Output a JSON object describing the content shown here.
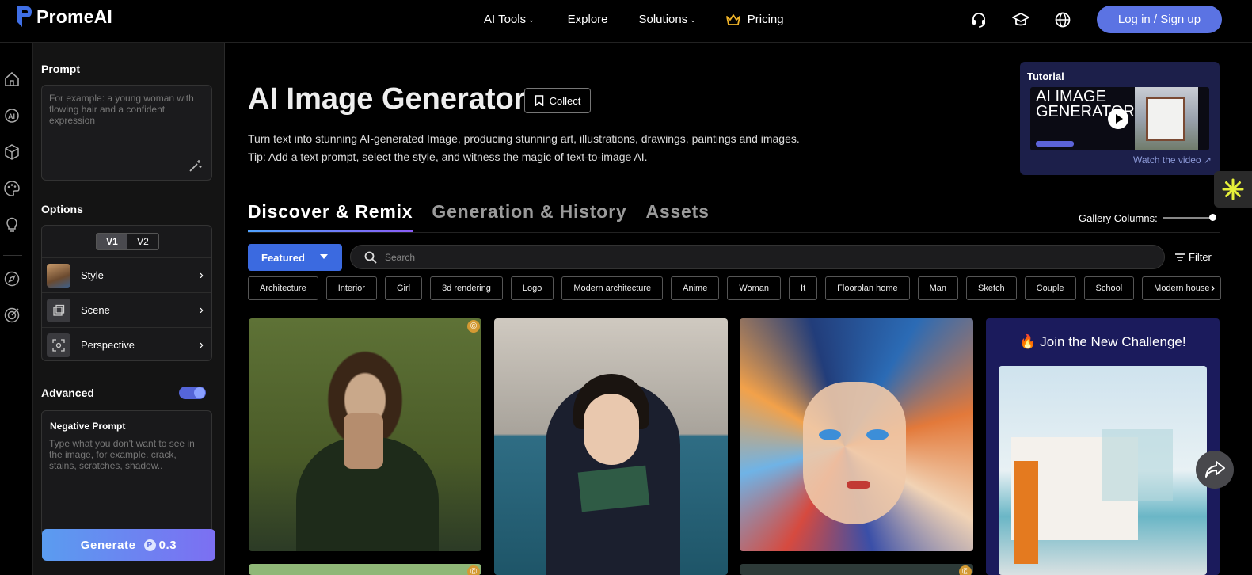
{
  "brand": {
    "name": "PromeAI"
  },
  "nav": {
    "ai_tools": "AI Tools",
    "explore": "Explore",
    "solutions": "Solutions",
    "pricing": "Pricing",
    "login": "Log in / Sign up"
  },
  "panel": {
    "prompt_heading": "Prompt",
    "prompt_placeholder": "For example: a young woman with flowing hair and a confident expression",
    "options_heading": "Options",
    "version_v1": "V1",
    "version_v2": "V2",
    "selected_version": "V1",
    "options": [
      {
        "label": "Style",
        "icon": "style-thumbnail"
      },
      {
        "label": "Scene",
        "icon": "scene-icon"
      },
      {
        "label": "Perspective",
        "icon": "perspective-icon"
      }
    ],
    "advanced_heading": "Advanced",
    "advanced_enabled": true,
    "negative_title": "Negative Prompt",
    "negative_placeholder": "Type what you don't want to see in the image, for example. crack, stains, scratches, shadow..",
    "generate_label": "Generate",
    "generate_cost": "0.3"
  },
  "main": {
    "title": "AI Image Generator",
    "collect": "Collect",
    "desc1": "Turn text into stunning AI-generated Image, producing stunning art, illustrations, drawings, paintings and images.",
    "desc2": "Tip: Add a text prompt, select the style, and witness the magic of text-to-image AI.",
    "tabs": [
      "Discover & Remix",
      "Generation & History",
      "Assets"
    ],
    "active_tab": "Discover & Remix",
    "gallery_columns_label": "Gallery Columns:",
    "featured": "Featured",
    "search_placeholder": "Search",
    "filter": "Filter",
    "chips": [
      "Architecture",
      "Interior",
      "Girl",
      "3d rendering",
      "Logo",
      "Modern architecture",
      "Anime",
      "Woman",
      "It",
      "Floorplan home",
      "Man",
      "Sketch",
      "Couple",
      "School",
      "Modern house"
    ],
    "challenge": "🔥 Join the New Challenge!"
  },
  "tutorial": {
    "title": "Tutorial",
    "video_text": "AI IMAGE GENERATOR",
    "link": "Watch the video ↗"
  },
  "colors": {
    "accent": "#5b73e3",
    "featured": "#3b6ae0",
    "tutorial_bg": "#1c1f4a",
    "challenge_bg": "#1b1b5c"
  }
}
